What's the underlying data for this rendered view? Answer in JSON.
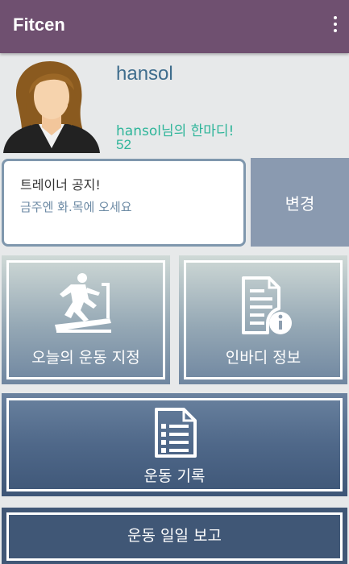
{
  "app": {
    "title": "Fitcen",
    "menu_icon": "overflow-menu-icon"
  },
  "profile": {
    "username": "hansol",
    "motto": "hansol님의 한마디!",
    "motto_value": "52",
    "avatar_icon": "user-avatar-icon"
  },
  "notice": {
    "title": "트레이너 공지!",
    "body": "금주엔 화.목에 오세요",
    "change_label": "변경"
  },
  "tiles": {
    "today_workout": {
      "label": "오늘의 운동 지정",
      "icon": "treadmill-runner-icon"
    },
    "inbody": {
      "label": "인바디 정보",
      "icon": "document-info-icon"
    },
    "workout_record": {
      "label": "운동 기록",
      "icon": "checklist-icon"
    },
    "daily_report": {
      "label": "운동 일일 보고"
    }
  },
  "colors": {
    "appbar": "#6f5070",
    "motto_text": "#2fb59a",
    "username_text": "#3f6d8d",
    "change_button": "#8a9ab0",
    "tile_dark": "#405776"
  }
}
